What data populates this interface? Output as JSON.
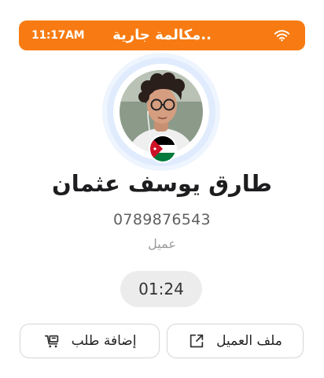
{
  "status_bar": {
    "time": "11:17AM",
    "label": "مكالمة جارية..",
    "icon": "wifi-icon",
    "color": "#f77b12"
  },
  "caller": {
    "name": "طارق يوسف عثمان",
    "phone": "0789876543",
    "role": "عميل",
    "flag": "jordan-flag-icon"
  },
  "call": {
    "duration": "01:24"
  },
  "actions": {
    "customer_profile": {
      "label": "ملف العميل",
      "icon": "open-external-icon"
    },
    "add_order": {
      "label": "إضافة طلب",
      "icon": "cart-add-icon"
    }
  }
}
